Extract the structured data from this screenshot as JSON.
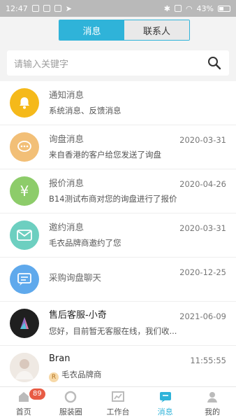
{
  "status_bar": {
    "time": "12:47",
    "battery": "43%"
  },
  "segment": {
    "tab_messages": "消息",
    "tab_contacts": "联系人"
  },
  "search": {
    "placeholder": "请输入关键字"
  },
  "messages": [
    {
      "title": "通知消息",
      "subtitle": "系统消息、反馈消息",
      "time": "",
      "icon": "bell-icon",
      "color": "#f5b91a"
    },
    {
      "title": "询盘消息",
      "subtitle": "来自香港的客户给您发送了询盘",
      "time": "2020-03-31",
      "icon": "chat-bubble-icon",
      "color": "#f2bf77"
    },
    {
      "title": "报价消息",
      "subtitle": "B14测试布商对您的询盘进行了报价",
      "time": "2020-04-26",
      "icon": "yen-icon",
      "color": "#8dcc6a"
    },
    {
      "title": "邀约消息",
      "subtitle": "毛衣品牌商邀约了您",
      "time": "2020-03-31",
      "icon": "envelope-icon",
      "color": "#6dcfc0"
    },
    {
      "title": "采购询盘聊天",
      "subtitle": "",
      "time": "2020-12-25",
      "icon": "chat-list-icon",
      "color": "#5fa9ec"
    },
    {
      "title": "售后客服-小奇",
      "subtitle": "您好，目前暂无客服在线，我们收...",
      "time": "2021-06-09",
      "icon": "service-avatar",
      "color": "#222222"
    },
    {
      "title": "Bran",
      "subtitle": "毛衣品牌商",
      "time": "11:55:55",
      "icon": "user-avatar",
      "color": "#e9e2dc"
    }
  ],
  "tabbar": {
    "home": "首页",
    "home_badge": "89",
    "fashion": "服装圈",
    "workbench": "工作台",
    "messages": "消息",
    "mine": "我的"
  },
  "colors": {
    "accent": "#2fb3d9",
    "badge": "#e85c45"
  }
}
